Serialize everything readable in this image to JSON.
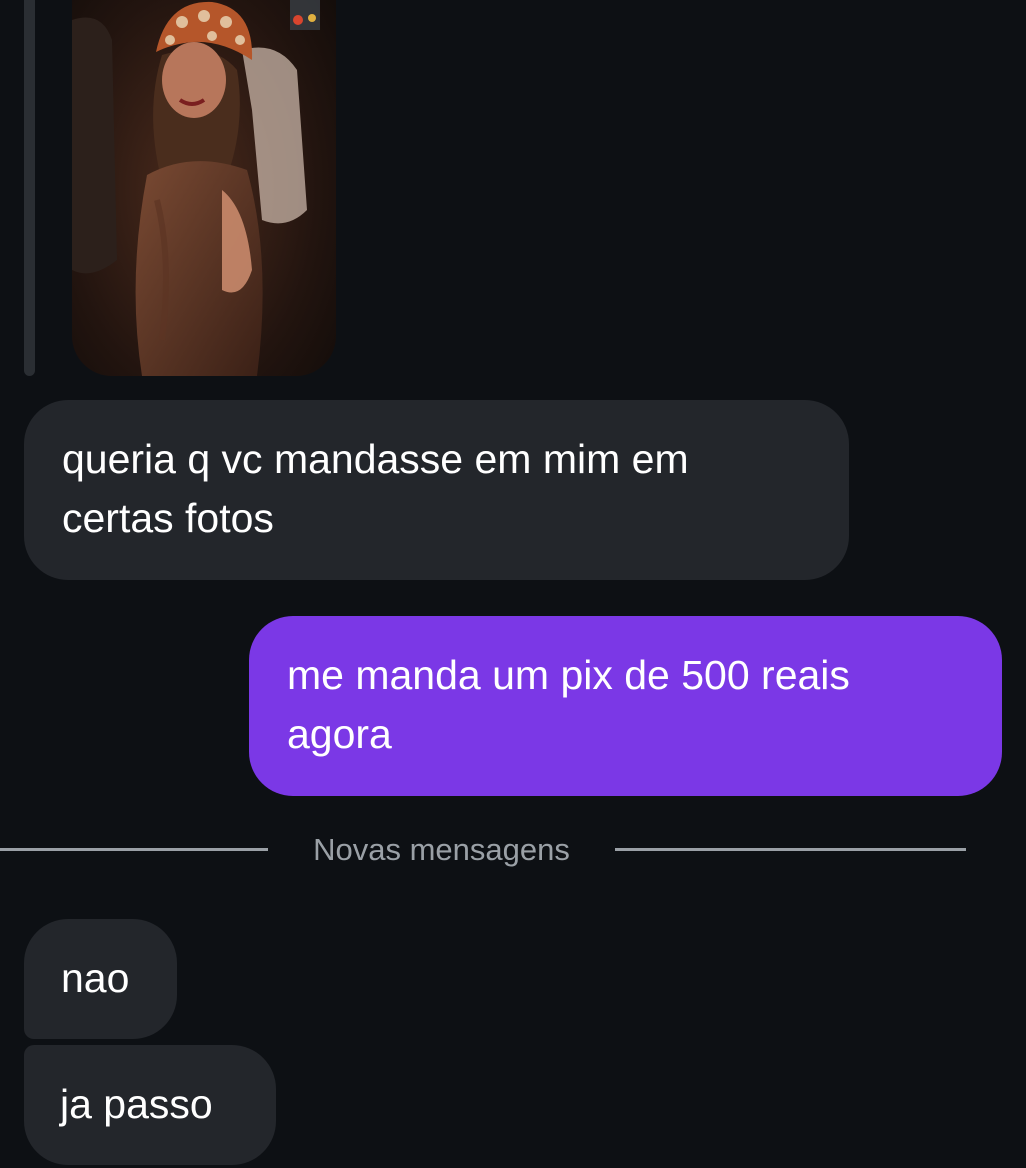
{
  "conversation": {
    "attachment": {
      "icon": "photo-attachment"
    },
    "messages": [
      {
        "direction": "incoming",
        "text": "queria q vc mandasse em mim em\ncertas fotos"
      },
      {
        "direction": "outgoing",
        "text": "me manda um pix de 500 reais\nagora"
      },
      {
        "direction": "incoming",
        "text": "nao"
      },
      {
        "direction": "incoming",
        "text": "ja passo"
      }
    ],
    "new_messages_divider": "Novas mensagens"
  },
  "colors": {
    "background": "#0d1014",
    "incoming_bubble": "#23262b",
    "outgoing_bubble": "#7b38e6",
    "divider": "#9aa0a6",
    "text": "#ffffff"
  }
}
